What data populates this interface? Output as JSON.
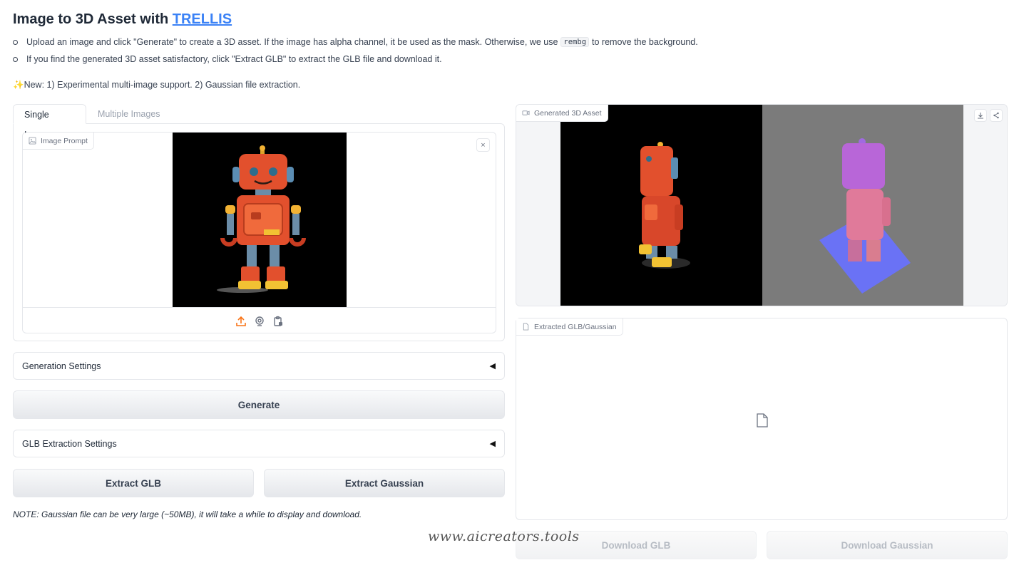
{
  "header": {
    "title_prefix": "Image to 3D Asset with ",
    "title_link": "TRELLIS"
  },
  "instructions": {
    "line1_a": "Upload an image and click \"Generate\" to create a 3D asset. If the image has alpha channel, it be used as the mask. Otherwise, we use",
    "line1_code": "rembg",
    "line1_b": "to remove the background.",
    "line2": "If you find the generated 3D asset satisfactory, click \"Extract GLB\" to extract the GLB file and download it.",
    "news_icon": "✨",
    "news": "New: 1) Experimental multi-image support. 2) Gaussian file extraction."
  },
  "tabs": [
    {
      "label": "Single Image",
      "active": true
    },
    {
      "label": "Multiple Images",
      "active": false
    }
  ],
  "image_prompt": {
    "label": "Image Prompt",
    "close": "×"
  },
  "generation_settings": {
    "label": "Generation Settings",
    "arrow": "◀"
  },
  "generate_button": "Generate",
  "glb_settings": {
    "label": "GLB Extraction Settings",
    "arrow": "◀"
  },
  "extract_glb_button": "Extract GLB",
  "extract_gaussian_button": "Extract Gaussian",
  "note": "NOTE: Gaussian file can be very large (~50MB), it will take a while to display and download.",
  "video": {
    "label": "Generated 3D Asset"
  },
  "file_output": {
    "label": "Extracted GLB/Gaussian"
  },
  "download_glb_button": "Download GLB",
  "download_gaussian_button": "Download Gaussian",
  "watermark": "www.aicreators.tools",
  "colors": {
    "link": "#3b82f6",
    "upload_icon": "#f97316"
  }
}
